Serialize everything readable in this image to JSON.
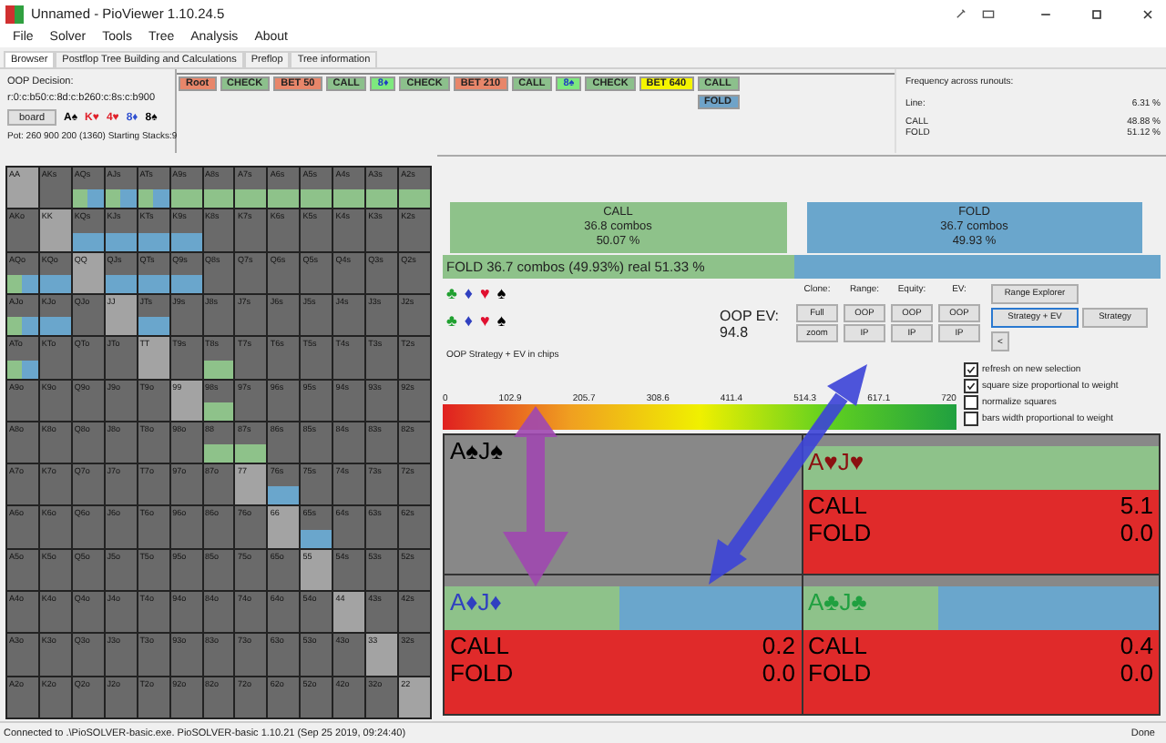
{
  "window": {
    "title": "Unnamed - PioViewer 1.10.24.5"
  },
  "menu": [
    "File",
    "Solver",
    "Tools",
    "Tree",
    "Analysis",
    "About"
  ],
  "tabs": [
    {
      "label": "Browser",
      "selected": true
    },
    {
      "label": "Postflop Tree Building and Calculations",
      "selected": false
    },
    {
      "label": "Preflop",
      "selected": false
    },
    {
      "label": "Tree information",
      "selected": false
    }
  ],
  "decision": {
    "title": "OOP Decision:",
    "line": "r:0:c:b50:c:8d:c:b260:c:8s:c:b900",
    "board_button": "board",
    "board": [
      {
        "card": "A♠",
        "color": "#000000"
      },
      {
        "card": "K♥",
        "color": "#e0202a"
      },
      {
        "card": "4♥",
        "color": "#e0202a"
      },
      {
        "card": "8♦",
        "color": "#3050d0"
      },
      {
        "card": "8♠",
        "color": "#000000"
      }
    ],
    "pot": "Pot: 260 900 200 (1360) Starting Stacks:9"
  },
  "tree": {
    "nodes": [
      {
        "options": [
          {
            "label": "Root",
            "kind": "root",
            "selected": false
          }
        ]
      },
      {
        "options": [
          {
            "label": "CHECK",
            "kind": "check",
            "selected": false
          }
        ]
      },
      {
        "options": [
          {
            "label": "BET 50",
            "kind": "bet",
            "selected": false
          }
        ]
      },
      {
        "options": [
          {
            "label": "CALL",
            "kind": "call",
            "selected": false
          }
        ]
      },
      {
        "options": [
          {
            "label": "8♦",
            "kind": "card",
            "selected": false
          }
        ]
      },
      {
        "options": [
          {
            "label": "CHECK",
            "kind": "check",
            "selected": false
          }
        ]
      },
      {
        "options": [
          {
            "label": "BET 210",
            "kind": "bet",
            "selected": false
          }
        ]
      },
      {
        "options": [
          {
            "label": "CALL",
            "kind": "call",
            "selected": false
          }
        ]
      },
      {
        "options": [
          {
            "label": "8♠",
            "kind": "card",
            "selected": false
          }
        ]
      },
      {
        "options": [
          {
            "label": "CHECK",
            "kind": "check",
            "selected": false
          }
        ]
      },
      {
        "options": [
          {
            "label": "BET 640",
            "kind": "bet",
            "selected": true
          }
        ]
      },
      {
        "options": [
          {
            "label": "CALL",
            "kind": "call",
            "selected": false
          },
          {
            "label": "FOLD",
            "kind": "fold",
            "selected": false
          }
        ]
      }
    ]
  },
  "frequency": {
    "title": "Frequency across runouts:",
    "line": {
      "label": "Line:",
      "value": "6.31 %"
    },
    "rows": [
      {
        "label": "CALL",
        "value": "48.88 %"
      },
      {
        "label": "FOLD",
        "value": "51.12 %"
      }
    ]
  },
  "hand_matrix": {
    "rows": [
      [
        {
          "label": "AA",
          "kind": "pair"
        },
        {
          "label": "AKs",
          "kind": "none"
        },
        {
          "label": "AQs",
          "kind": "mixed"
        },
        {
          "label": "AJs",
          "kind": "mixed"
        },
        {
          "label": "ATs",
          "kind": "mixed"
        },
        {
          "label": "A9s",
          "kind": "call"
        },
        {
          "label": "A8s",
          "kind": "call"
        },
        {
          "label": "A7s",
          "kind": "call"
        },
        {
          "label": "A6s",
          "kind": "call"
        },
        {
          "label": "A5s",
          "kind": "call"
        },
        {
          "label": "A4s",
          "kind": "call"
        },
        {
          "label": "A3s",
          "kind": "call"
        },
        {
          "label": "A2s",
          "kind": "call"
        }
      ],
      [
        {
          "label": "AKo",
          "kind": "none"
        },
        {
          "label": "KK",
          "kind": "pair"
        },
        {
          "label": "KQs",
          "kind": "fold"
        },
        {
          "label": "KJs",
          "kind": "fold"
        },
        {
          "label": "KTs",
          "kind": "fold"
        },
        {
          "label": "K9s",
          "kind": "fold"
        },
        {
          "label": "K8s",
          "kind": "none"
        },
        {
          "label": "K7s",
          "kind": "none"
        },
        {
          "label": "K6s",
          "kind": "none"
        },
        {
          "label": "K5s",
          "kind": "none"
        },
        {
          "label": "K4s",
          "kind": "none"
        },
        {
          "label": "K3s",
          "kind": "none"
        },
        {
          "label": "K2s",
          "kind": "none"
        }
      ],
      [
        {
          "label": "AQo",
          "kind": "mixed"
        },
        {
          "label": "KQo",
          "kind": "fold"
        },
        {
          "label": "QQ",
          "kind": "pair"
        },
        {
          "label": "QJs",
          "kind": "fold"
        },
        {
          "label": "QTs",
          "kind": "fold"
        },
        {
          "label": "Q9s",
          "kind": "fold"
        },
        {
          "label": "Q8s",
          "kind": "none"
        },
        {
          "label": "Q7s",
          "kind": "none"
        },
        {
          "label": "Q6s",
          "kind": "none"
        },
        {
          "label": "Q5s",
          "kind": "none"
        },
        {
          "label": "Q4s",
          "kind": "none"
        },
        {
          "label": "Q3s",
          "kind": "none"
        },
        {
          "label": "Q2s",
          "kind": "none"
        }
      ],
      [
        {
          "label": "AJo",
          "kind": "mixed"
        },
        {
          "label": "KJo",
          "kind": "fold"
        },
        {
          "label": "QJo",
          "kind": "none"
        },
        {
          "label": "JJ",
          "kind": "pair"
        },
        {
          "label": "JTs",
          "kind": "fold"
        },
        {
          "label": "J9s",
          "kind": "none"
        },
        {
          "label": "J8s",
          "kind": "none"
        },
        {
          "label": "J7s",
          "kind": "none"
        },
        {
          "label": "J6s",
          "kind": "none"
        },
        {
          "label": "J5s",
          "kind": "none"
        },
        {
          "label": "J4s",
          "kind": "none"
        },
        {
          "label": "J3s",
          "kind": "none"
        },
        {
          "label": "J2s",
          "kind": "none"
        }
      ],
      [
        {
          "label": "ATo",
          "kind": "mixed"
        },
        {
          "label": "KTo",
          "kind": "none"
        },
        {
          "label": "QTo",
          "kind": "none"
        },
        {
          "label": "JTo",
          "kind": "none"
        },
        {
          "label": "TT",
          "kind": "pair"
        },
        {
          "label": "T9s",
          "kind": "none"
        },
        {
          "label": "T8s",
          "kind": "call"
        },
        {
          "label": "T7s",
          "kind": "none"
        },
        {
          "label": "T6s",
          "kind": "none"
        },
        {
          "label": "T5s",
          "kind": "none"
        },
        {
          "label": "T4s",
          "kind": "none"
        },
        {
          "label": "T3s",
          "kind": "none"
        },
        {
          "label": "T2s",
          "kind": "none"
        }
      ],
      [
        {
          "label": "A9o",
          "kind": "none"
        },
        {
          "label": "K9o",
          "kind": "none"
        },
        {
          "label": "Q9o",
          "kind": "none"
        },
        {
          "label": "J9o",
          "kind": "none"
        },
        {
          "label": "T9o",
          "kind": "none"
        },
        {
          "label": "99",
          "kind": "pair"
        },
        {
          "label": "98s",
          "kind": "call"
        },
        {
          "label": "97s",
          "kind": "none"
        },
        {
          "label": "96s",
          "kind": "none"
        },
        {
          "label": "95s",
          "kind": "none"
        },
        {
          "label": "94s",
          "kind": "none"
        },
        {
          "label": "93s",
          "kind": "none"
        },
        {
          "label": "92s",
          "kind": "none"
        }
      ],
      [
        {
          "label": "A8o",
          "kind": "none"
        },
        {
          "label": "K8o",
          "kind": "none"
        },
        {
          "label": "Q8o",
          "kind": "none"
        },
        {
          "label": "J8o",
          "kind": "none"
        },
        {
          "label": "T8o",
          "kind": "none"
        },
        {
          "label": "98o",
          "kind": "none"
        },
        {
          "label": "88",
          "kind": "call"
        },
        {
          "label": "87s",
          "kind": "call"
        },
        {
          "label": "86s",
          "kind": "none"
        },
        {
          "label": "85s",
          "kind": "none"
        },
        {
          "label": "84s",
          "kind": "none"
        },
        {
          "label": "83s",
          "kind": "none"
        },
        {
          "label": "82s",
          "kind": "none"
        }
      ],
      [
        {
          "label": "A7o",
          "kind": "none"
        },
        {
          "label": "K7o",
          "kind": "none"
        },
        {
          "label": "Q7o",
          "kind": "none"
        },
        {
          "label": "J7o",
          "kind": "none"
        },
        {
          "label": "T7o",
          "kind": "none"
        },
        {
          "label": "97o",
          "kind": "none"
        },
        {
          "label": "87o",
          "kind": "none"
        },
        {
          "label": "77",
          "kind": "pair"
        },
        {
          "label": "76s",
          "kind": "fold"
        },
        {
          "label": "75s",
          "kind": "none"
        },
        {
          "label": "74s",
          "kind": "none"
        },
        {
          "label": "73s",
          "kind": "none"
        },
        {
          "label": "72s",
          "kind": "none"
        }
      ],
      [
        {
          "label": "A6o",
          "kind": "none"
        },
        {
          "label": "K6o",
          "kind": "none"
        },
        {
          "label": "Q6o",
          "kind": "none"
        },
        {
          "label": "J6o",
          "kind": "none"
        },
        {
          "label": "T6o",
          "kind": "none"
        },
        {
          "label": "96o",
          "kind": "none"
        },
        {
          "label": "86o",
          "kind": "none"
        },
        {
          "label": "76o",
          "kind": "none"
        },
        {
          "label": "66",
          "kind": "pair"
        },
        {
          "label": "65s",
          "kind": "fold"
        },
        {
          "label": "64s",
          "kind": "none"
        },
        {
          "label": "63s",
          "kind": "none"
        },
        {
          "label": "62s",
          "kind": "none"
        }
      ],
      [
        {
          "label": "A5o",
          "kind": "none"
        },
        {
          "label": "K5o",
          "kind": "none"
        },
        {
          "label": "Q5o",
          "kind": "none"
        },
        {
          "label": "J5o",
          "kind": "none"
        },
        {
          "label": "T5o",
          "kind": "none"
        },
        {
          "label": "95o",
          "kind": "none"
        },
        {
          "label": "85o",
          "kind": "none"
        },
        {
          "label": "75o",
          "kind": "none"
        },
        {
          "label": "65o",
          "kind": "none"
        },
        {
          "label": "55",
          "kind": "pair"
        },
        {
          "label": "54s",
          "kind": "none"
        },
        {
          "label": "53s",
          "kind": "none"
        },
        {
          "label": "52s",
          "kind": "none"
        }
      ],
      [
        {
          "label": "A4o",
          "kind": "none"
        },
        {
          "label": "K4o",
          "kind": "none"
        },
        {
          "label": "Q4o",
          "kind": "none"
        },
        {
          "label": "J4o",
          "kind": "none"
        },
        {
          "label": "T4o",
          "kind": "none"
        },
        {
          "label": "94o",
          "kind": "none"
        },
        {
          "label": "84o",
          "kind": "none"
        },
        {
          "label": "74o",
          "kind": "none"
        },
        {
          "label": "64o",
          "kind": "none"
        },
        {
          "label": "54o",
          "kind": "none"
        },
        {
          "label": "44",
          "kind": "pair"
        },
        {
          "label": "43s",
          "kind": "none"
        },
        {
          "label": "42s",
          "kind": "none"
        }
      ],
      [
        {
          "label": "A3o",
          "kind": "none"
        },
        {
          "label": "K3o",
          "kind": "none"
        },
        {
          "label": "Q3o",
          "kind": "none"
        },
        {
          "label": "J3o",
          "kind": "none"
        },
        {
          "label": "T3o",
          "kind": "none"
        },
        {
          "label": "93o",
          "kind": "none"
        },
        {
          "label": "83o",
          "kind": "none"
        },
        {
          "label": "73o",
          "kind": "none"
        },
        {
          "label": "63o",
          "kind": "none"
        },
        {
          "label": "53o",
          "kind": "none"
        },
        {
          "label": "43o",
          "kind": "none"
        },
        {
          "label": "33",
          "kind": "pair"
        },
        {
          "label": "32s",
          "kind": "none"
        }
      ],
      [
        {
          "label": "A2o",
          "kind": "none"
        },
        {
          "label": "K2o",
          "kind": "none"
        },
        {
          "label": "Q2o",
          "kind": "none"
        },
        {
          "label": "J2o",
          "kind": "none"
        },
        {
          "label": "T2o",
          "kind": "none"
        },
        {
          "label": "92o",
          "kind": "none"
        },
        {
          "label": "82o",
          "kind": "none"
        },
        {
          "label": "72o",
          "kind": "none"
        },
        {
          "label": "62o",
          "kind": "none"
        },
        {
          "label": "52o",
          "kind": "none"
        },
        {
          "label": "42o",
          "kind": "none"
        },
        {
          "label": "32o",
          "kind": "none"
        },
        {
          "label": "22",
          "kind": "pair"
        }
      ]
    ]
  },
  "strategy": {
    "actions": [
      {
        "name": "CALL",
        "combos": "36.8 combos",
        "percent": "50.07 %",
        "kind": "call"
      },
      {
        "name": "FOLD",
        "combos": "36.7 combos",
        "percent": "49.93 %",
        "kind": "fold"
      }
    ],
    "summary": {
      "text": "FOLD  36.7 combos (49.93%) real  51.33 %",
      "level": 0.49
    },
    "suit_rows": [
      [
        {
          "suit": "♣",
          "color": "#20a030"
        },
        {
          "suit": "♦",
          "color": "#3040c0"
        },
        {
          "suit": "♥",
          "color": "#e01030"
        },
        {
          "suit": "♠",
          "color": "#000000"
        }
      ],
      [
        {
          "suit": "♣",
          "color": "#20a030"
        },
        {
          "suit": "♦",
          "color": "#3040c0"
        },
        {
          "suit": "♥",
          "color": "#e01030"
        },
        {
          "suit": "♠",
          "color": "#000000"
        }
      ]
    ],
    "ev": {
      "label": "OOP EV:",
      "value": "94.8"
    },
    "control_groups": [
      {
        "label": "Clone:",
        "buttons": [
          "Full",
          "zoom"
        ]
      },
      {
        "label": "Range:",
        "buttons": [
          "OOP",
          "IP"
        ]
      },
      {
        "label": "Equity:",
        "buttons": [
          "OOP",
          "IP"
        ]
      },
      {
        "label": "EV:",
        "buttons": [
          "OOP",
          "IP"
        ]
      }
    ],
    "range_explorer": "Range Explorer",
    "views": [
      {
        "label": "Strategy + EV",
        "selected": true
      },
      {
        "label": "Strategy",
        "selected": false
      }
    ],
    "collapse": "<",
    "options": [
      {
        "label": "refresh on new selection",
        "checked": true
      },
      {
        "label": "square size proportional to weight",
        "checked": true
      },
      {
        "label": "normalize squares",
        "checked": false
      },
      {
        "label": "bars width proportional to weight",
        "checked": false
      }
    ],
    "scale": {
      "caption": "OOP Strategy + EV in chips",
      "ticks": [
        "0",
        "102.9",
        "205.7",
        "308.6",
        "411.4",
        "514.3",
        "617.1",
        "720"
      ]
    },
    "combos": [
      {
        "hand": "A♠J♠",
        "color": "#000000",
        "kind": "inactive"
      },
      {
        "hand": "A♥J♥",
        "color": "#8b1010",
        "kind": "active",
        "level": 1,
        "rows": [
          {
            "name": "CALL",
            "value": "5.1"
          },
          {
            "name": "FOLD",
            "value": "0.0"
          }
        ]
      },
      {
        "hand": "A♦J♦",
        "color": "#3040c0",
        "kind": "active",
        "level": 0.49,
        "rows": [
          {
            "name": "CALL",
            "value": "0.2"
          },
          {
            "name": "FOLD",
            "value": "0.0"
          }
        ]
      },
      {
        "hand": "A♣J♣",
        "color": "#20a040",
        "kind": "active",
        "level": 0.38,
        "rows": [
          {
            "name": "CALL",
            "value": "0.4"
          },
          {
            "name": "FOLD",
            "value": "0.0"
          }
        ]
      }
    ]
  },
  "status_bar": {
    "text": "Connected to .\\PioSOLVER-basic.exe. PioSOLVER-basic 1.10.21 (Sep 25 2019, 09:24:40)",
    "state": "Done"
  }
}
